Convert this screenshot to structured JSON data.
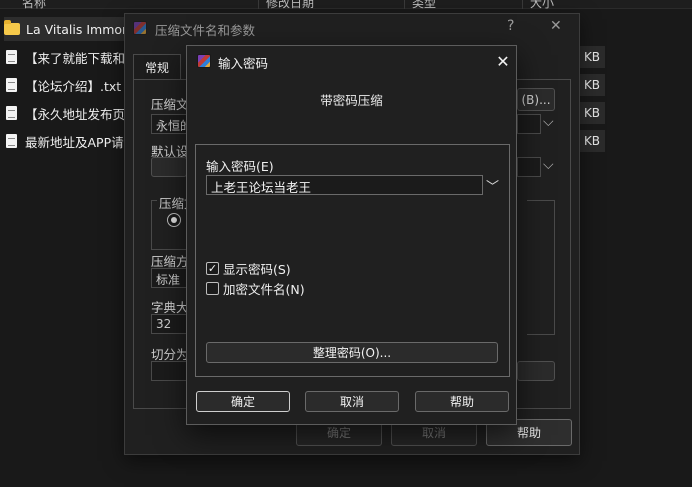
{
  "explorer": {
    "columns": [
      "名称",
      "修改日期",
      "类型",
      "大小"
    ],
    "files": [
      {
        "name": "La Vitalis Immortal",
        "icon": "folder-icon",
        "size": ""
      },
      {
        "name": "【来了就能下载和",
        "icon": "document-icon",
        "size": "KB"
      },
      {
        "name": "【论坛介绍】.txt",
        "icon": "document-icon",
        "size": "KB"
      },
      {
        "name": "【永久地址发布页",
        "icon": "document-icon",
        "size": "KB"
      },
      {
        "name": "最新地址及APP请",
        "icon": "document-icon",
        "size": "KB"
      }
    ]
  },
  "parent_dialog": {
    "title": "压缩文件名和参数",
    "help_glyph": "?",
    "close_glyph": "✕",
    "tab_general": "常规",
    "archive_name_label": "压缩文",
    "archive_name_value": "永恒的",
    "browse_button": "(B)...",
    "default_profile_label": "默认设",
    "format_group_label": "压缩文",
    "method_label": "压缩方",
    "method_value": "标准",
    "dict_label": "字典大",
    "dict_value": "32",
    "split_label": "切分为",
    "ok_label": "确定",
    "cancel_label": "取消",
    "help_label": "帮助"
  },
  "password_dialog": {
    "title": "输入密码",
    "close_glyph": "✕",
    "heading": "带密码压缩",
    "enter_password_label": "输入密码(E)",
    "password_value": "上老王论坛当老王",
    "dropdown_glyph": "﹀",
    "show_password_label": "显示密码(S)",
    "show_password_checked": true,
    "check_glyph": "✓",
    "encrypt_names_label": "加密文件名(N)",
    "encrypt_names_checked": false,
    "organize_button": "整理密码(O)...",
    "ok_button": "确定",
    "cancel_button": "取消",
    "help_button": "帮助"
  },
  "colors": {
    "background": "#191919",
    "dialog": "#202020",
    "border": "#6a6a6a",
    "folder": "#f6c94a"
  }
}
